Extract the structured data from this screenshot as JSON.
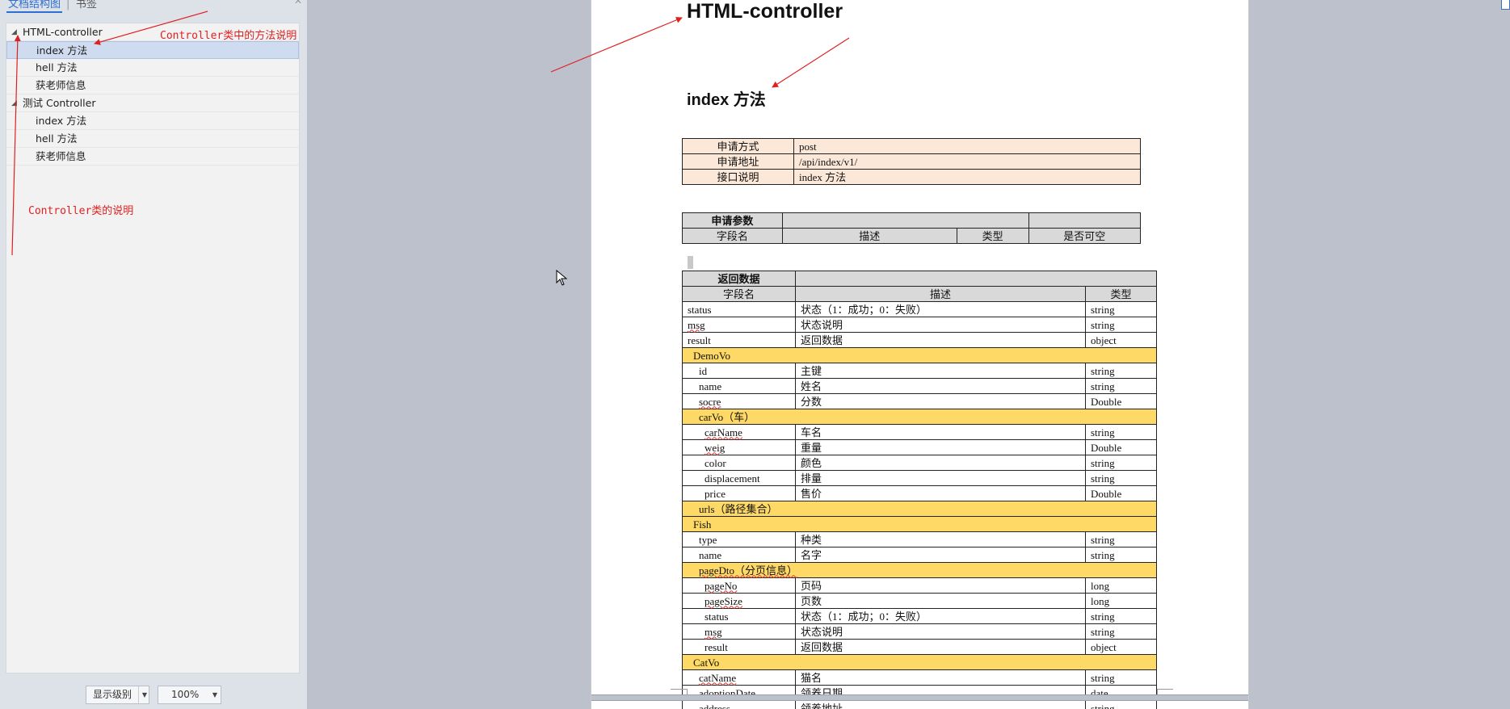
{
  "left_pane": {
    "tabs": [
      "文档结构图",
      "书签"
    ],
    "tab_separator": "|",
    "tree": [
      {
        "label": "HTML-controller",
        "level": 0,
        "expanded": true,
        "selected": false
      },
      {
        "label": "index 方法",
        "level": 1,
        "selected": true
      },
      {
        "label": "hell 方法",
        "level": 1,
        "selected": false
      },
      {
        "label": "获老师信息",
        "level": 1,
        "selected": false
      },
      {
        "label": "测试 Controller",
        "level": 0,
        "expanded": true,
        "selected": false
      },
      {
        "label": "index 方法",
        "level": 1,
        "selected": false
      },
      {
        "label": "hell 方法",
        "level": 1,
        "selected": false
      },
      {
        "label": "获老师信息",
        "level": 1,
        "selected": false
      }
    ],
    "level_select": "显示级别",
    "zoom_select": "100%"
  },
  "annotations": {
    "method_note": "Controller类中的方法说明",
    "class_note": "Controller类的说明"
  },
  "document": {
    "title": "HTML-controller",
    "subtitle": "index 方法",
    "request_info": [
      {
        "key": "申请方式",
        "value": "post"
      },
      {
        "key": "申请地址",
        "value": "/api/index/v1/"
      },
      {
        "key": "接口说明",
        "value": "index 方法"
      }
    ],
    "request_params": {
      "title": "申请参数",
      "headers": [
        "字段名",
        "描述",
        "类型",
        "是否可空"
      ]
    },
    "return_data": {
      "title": "返回数据",
      "headers": [
        "字段名",
        "描述",
        "类型"
      ],
      "rows": [
        {
          "name": "status",
          "desc": "状态（1：成功；0：失败）",
          "type": "string",
          "indent": 0
        },
        {
          "name": "msg",
          "desc": "状态说明",
          "type": "string",
          "indent": 0,
          "squiggle": true
        },
        {
          "name": "result",
          "desc": "返回数据",
          "type": "object",
          "indent": 0
        },
        {
          "group": "DemoVo",
          "indent": 1
        },
        {
          "name": "id",
          "desc": "主键",
          "type": "string",
          "indent": 2
        },
        {
          "name": "name",
          "desc": "姓名",
          "type": "string",
          "indent": 2
        },
        {
          "name": "socre",
          "desc": "分数",
          "type": "Double",
          "indent": 2,
          "squiggle": true
        },
        {
          "group": "carVo（车）",
          "indent": 2
        },
        {
          "name": "carName",
          "desc": "车名",
          "type": "string",
          "indent": 3,
          "squiggle": true
        },
        {
          "name": "weig",
          "desc": "重量",
          "type": "Double",
          "indent": 3,
          "squiggle": true
        },
        {
          "name": "color",
          "desc": "颜色",
          "type": "string",
          "indent": 3
        },
        {
          "name": "displacement",
          "desc": "排量",
          "type": "string",
          "indent": 3
        },
        {
          "name": "price",
          "desc": "售价",
          "type": "Double",
          "indent": 3
        },
        {
          "group": "urls（路径集合）",
          "indent": 2
        },
        {
          "group": "Fish",
          "indent": 1
        },
        {
          "name": "type",
          "desc": "种类",
          "type": "string",
          "indent": 2
        },
        {
          "name": "name",
          "desc": "名字",
          "type": "string",
          "indent": 2
        },
        {
          "group": "pageDto（分页信息）",
          "indent": 2,
          "squiggle": true
        },
        {
          "name": "pageNo",
          "desc": "页码",
          "type": "long",
          "indent": 3,
          "squiggle": true
        },
        {
          "name": "pageSize",
          "desc": "页数",
          "type": "long",
          "indent": 3,
          "squiggle": true
        },
        {
          "name": "status",
          "desc": "状态（1：成功；0：失败）",
          "type": "string",
          "indent": 3
        },
        {
          "name": "msg",
          "desc": "状态说明",
          "type": "string",
          "indent": 3,
          "squiggle": true
        },
        {
          "name": "result",
          "desc": "返回数据",
          "type": "object",
          "indent": 3
        },
        {
          "group": "CatVo",
          "indent": 1
        },
        {
          "name": "catName",
          "desc": "猫名",
          "type": "string",
          "indent": 2,
          "squiggle": true
        },
        {
          "name": "adoptionDate",
          "desc": "领养日期",
          "type": "date",
          "indent": 2,
          "squiggle": true
        },
        {
          "name": "address",
          "desc": "领养地址",
          "type": "string",
          "indent": 2
        }
      ]
    }
  },
  "colors": {
    "request_bg": "#fce8d8",
    "group_bg": "#ffd966",
    "header_bg": "#d9d9d9",
    "annotation": "#e02020",
    "selection": "#cfdcf0"
  }
}
